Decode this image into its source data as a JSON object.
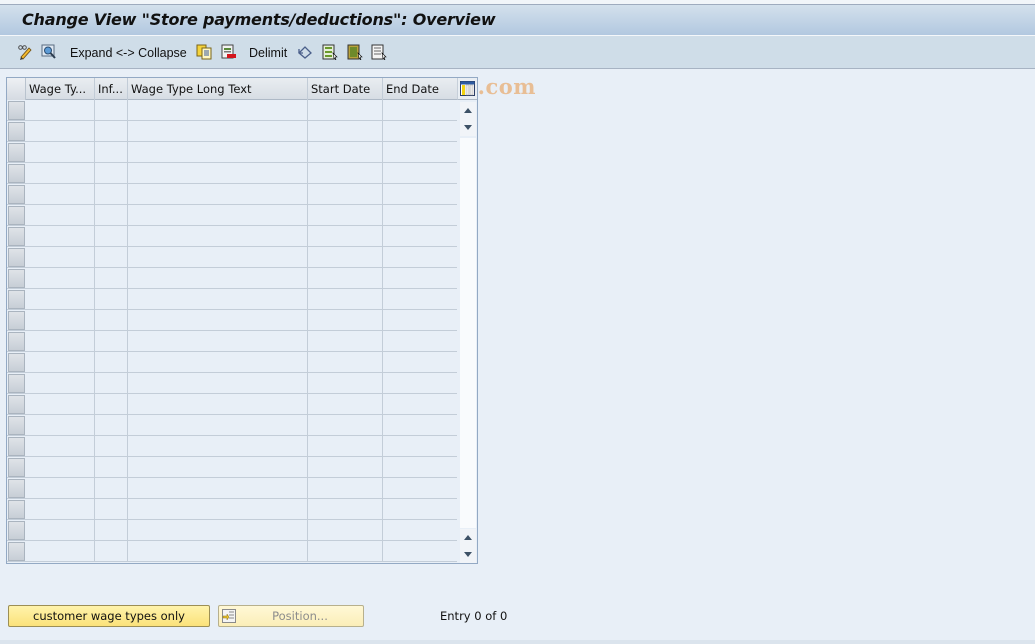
{
  "window": {
    "title": "Change View \"Store payments/deductions\": Overview"
  },
  "toolbar": {
    "items": [
      {
        "name": "change-display-icon",
        "type": "icon"
      },
      {
        "name": "find-icon",
        "type": "icon"
      },
      {
        "name": "expand-collapse",
        "type": "text",
        "label": "Expand <-> Collapse"
      },
      {
        "name": "copy-as-icon",
        "type": "icon"
      },
      {
        "name": "delete-icon",
        "type": "icon"
      },
      {
        "name": "delimit",
        "type": "text",
        "label": "Delimit"
      },
      {
        "name": "undo-change-icon",
        "type": "icon"
      },
      {
        "name": "select-all-icon",
        "type": "icon"
      },
      {
        "name": "select-block-icon",
        "type": "icon"
      },
      {
        "name": "deselect-all-icon",
        "type": "icon"
      }
    ],
    "expand_label": "Expand <-> Collapse",
    "delimit_label": "Delimit"
  },
  "watermark": "www.tutorialkart.com",
  "table": {
    "columns": [
      {
        "key": "wage_type",
        "label": "Wage Ty..."
      },
      {
        "key": "inf",
        "label": "Inf..."
      },
      {
        "key": "long_text",
        "label": "Wage Type Long Text"
      },
      {
        "key": "start_date",
        "label": "Start Date"
      },
      {
        "key": "end_date",
        "label": "End Date"
      }
    ],
    "rows": [
      {},
      {},
      {},
      {},
      {},
      {},
      {},
      {},
      {},
      {},
      {},
      {},
      {},
      {},
      {},
      {},
      {},
      {},
      {},
      {},
      {},
      {}
    ]
  },
  "footer": {
    "customer_button": "customer wage types only",
    "position_button": "Position...",
    "entry_text": "Entry 0 of 0"
  }
}
